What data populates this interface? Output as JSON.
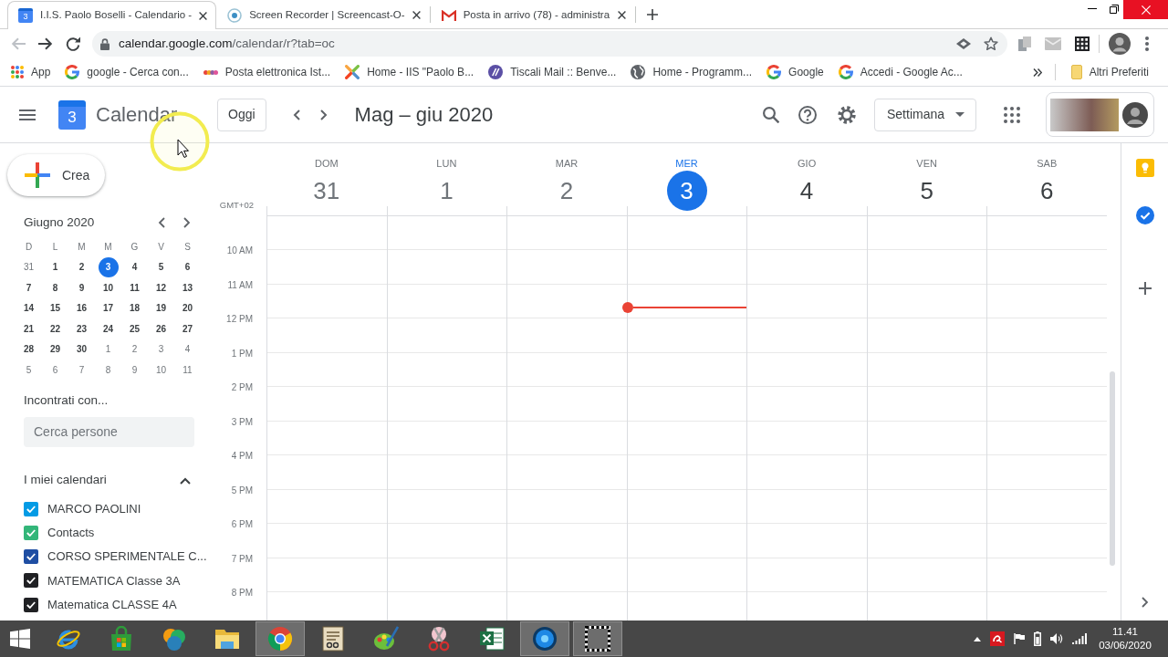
{
  "browser": {
    "tabs": [
      {
        "title": "I.I.S. Paolo Boselli - Calendario -",
        "kind": "calendar",
        "icon_text": "3",
        "selected": true
      },
      {
        "title": "Screen Recorder | Screencast-O-",
        "kind": "recorder",
        "selected": false
      },
      {
        "title": "Posta in arrivo (78) - administra",
        "kind": "mail",
        "selected": false
      }
    ],
    "address": {
      "host": "calendar.google.com",
      "path": "/calendar/r?tab=oc"
    },
    "bookmarks": [
      {
        "label": "App",
        "kind": "apps"
      },
      {
        "label": "google - Cerca con...",
        "kind": "google"
      },
      {
        "label": "Posta elettronica Ist...",
        "kind": "dots"
      },
      {
        "label": "Home - IIS \"Paolo B...",
        "kind": "cross"
      },
      {
        "label": "Tiscali Mail :: Benve...",
        "kind": "slashes"
      },
      {
        "label": "Home - Programm...",
        "kind": "globe"
      },
      {
        "label": "Google",
        "kind": "google"
      },
      {
        "label": "Accedi - Google Ac...",
        "kind": "google"
      }
    ],
    "other_bookmarks": "Altri Preferiti"
  },
  "calendar": {
    "logo_day": "3",
    "app_name": "Calendar",
    "today_button": "Oggi",
    "range_title": "Mag – giu 2020",
    "view_select": "Settimana",
    "create_button": "Crea",
    "mini_calendar": {
      "title": "Giugno 2020",
      "weekdays": [
        "D",
        "L",
        "M",
        "M",
        "G",
        "V",
        "S"
      ],
      "weeks": [
        [
          {
            "day": "31",
            "outside": true,
            "selected": false
          },
          {
            "day": "1",
            "outside": false,
            "selected": false
          },
          {
            "day": "2",
            "outside": false,
            "selected": false
          },
          {
            "day": "3",
            "outside": false,
            "selected": true
          },
          {
            "day": "4",
            "outside": false,
            "selected": false
          },
          {
            "day": "5",
            "outside": false,
            "selected": false
          },
          {
            "day": "6",
            "outside": false,
            "selected": false
          }
        ],
        [
          {
            "day": "7",
            "outside": false,
            "selected": false
          },
          {
            "day": "8",
            "outside": false,
            "selected": false
          },
          {
            "day": "9",
            "outside": false,
            "selected": false
          },
          {
            "day": "10",
            "outside": false,
            "selected": false
          },
          {
            "day": "11",
            "outside": false,
            "selected": false
          },
          {
            "day": "12",
            "outside": false,
            "selected": false
          },
          {
            "day": "13",
            "outside": false,
            "selected": false
          }
        ],
        [
          {
            "day": "14",
            "outside": false,
            "selected": false
          },
          {
            "day": "15",
            "outside": false,
            "selected": false
          },
          {
            "day": "16",
            "outside": false,
            "selected": false
          },
          {
            "day": "17",
            "outside": false,
            "selected": false
          },
          {
            "day": "18",
            "outside": false,
            "selected": false
          },
          {
            "day": "19",
            "outside": false,
            "selected": false
          },
          {
            "day": "20",
            "outside": false,
            "selected": false
          }
        ],
        [
          {
            "day": "21",
            "outside": false,
            "selected": false
          },
          {
            "day": "22",
            "outside": false,
            "selected": false
          },
          {
            "day": "23",
            "outside": false,
            "selected": false
          },
          {
            "day": "24",
            "outside": false,
            "selected": false
          },
          {
            "day": "25",
            "outside": false,
            "selected": false
          },
          {
            "day": "26",
            "outside": false,
            "selected": false
          },
          {
            "day": "27",
            "outside": false,
            "selected": false
          }
        ],
        [
          {
            "day": "28",
            "outside": false,
            "selected": false
          },
          {
            "day": "29",
            "outside": false,
            "selected": false
          },
          {
            "day": "30",
            "outside": false,
            "selected": false
          },
          {
            "day": "1",
            "outside": true,
            "selected": false
          },
          {
            "day": "2",
            "outside": true,
            "selected": false
          },
          {
            "day": "3",
            "outside": true,
            "selected": false
          },
          {
            "day": "4",
            "outside": true,
            "selected": false
          }
        ],
        [
          {
            "day": "5",
            "outside": true,
            "selected": false
          },
          {
            "day": "6",
            "outside": true,
            "selected": false
          },
          {
            "day": "7",
            "outside": true,
            "selected": false
          },
          {
            "day": "8",
            "outside": true,
            "selected": false
          },
          {
            "day": "9",
            "outside": true,
            "selected": false
          },
          {
            "day": "10",
            "outside": true,
            "selected": false
          },
          {
            "day": "11",
            "outside": true,
            "selected": false
          }
        ]
      ]
    },
    "people_search": {
      "heading": "Incontrati con...",
      "placeholder": "Cerca persone"
    },
    "my_calendars": {
      "heading": "I miei calendari",
      "expanded": true,
      "items": [
        {
          "name": "MARCO PAOLINI",
          "checked": true,
          "color": "#039be5"
        },
        {
          "name": "Contacts",
          "checked": true,
          "color": "#33b679"
        },
        {
          "name": "CORSO SPERIMENTALE C...",
          "checked": true,
          "color": "#1f4ea3"
        },
        {
          "name": "MATEMATICA Classe 3A",
          "checked": true,
          "color": "#202124"
        },
        {
          "name": "Matematica CLASSE 4A",
          "checked": true,
          "color": "#202124"
        }
      ]
    },
    "time_zone": "GMT+02",
    "days": [
      {
        "weekday": "DOM",
        "date": "31",
        "past": true,
        "selected": false,
        "current_time": false
      },
      {
        "weekday": "LUN",
        "date": "1",
        "past": true,
        "selected": false,
        "current_time": false
      },
      {
        "weekday": "MAR",
        "date": "2",
        "past": true,
        "selected": false,
        "current_time": false
      },
      {
        "weekday": "MER",
        "date": "3",
        "past": false,
        "selected": true,
        "current_time": true
      },
      {
        "weekday": "GIO",
        "date": "4",
        "past": false,
        "selected": false,
        "current_time": false
      },
      {
        "weekday": "VEN",
        "date": "5",
        "past": false,
        "selected": false,
        "current_time": false
      },
      {
        "weekday": "SAB",
        "date": "6",
        "past": false,
        "selected": false,
        "current_time": false
      }
    ],
    "hours": [
      "10 AM",
      "11 AM",
      "12 PM",
      "1 PM",
      "2 PM",
      "3 PM",
      "4 PM",
      "5 PM",
      "6 PM",
      "7 PM",
      "8 PM"
    ]
  },
  "taskbar": {
    "apps": [
      {
        "kind": "e",
        "selected": false
      },
      {
        "kind": "bag",
        "selected": false
      },
      {
        "kind": "orbs",
        "selected": false
      },
      {
        "kind": "folder",
        "selected": false
      },
      {
        "kind": "wheel",
        "selected": true
      },
      {
        "kind": "notepad",
        "selected": false
      },
      {
        "kind": "palette",
        "selected": false
      },
      {
        "kind": "scissors",
        "selected": false
      },
      {
        "kind": "sheet",
        "selected": false
      },
      {
        "kind": "disc",
        "selected": true
      },
      {
        "kind": "dashed",
        "selected": true
      }
    ],
    "time": "11.41",
    "date": "03/06/2020"
  }
}
